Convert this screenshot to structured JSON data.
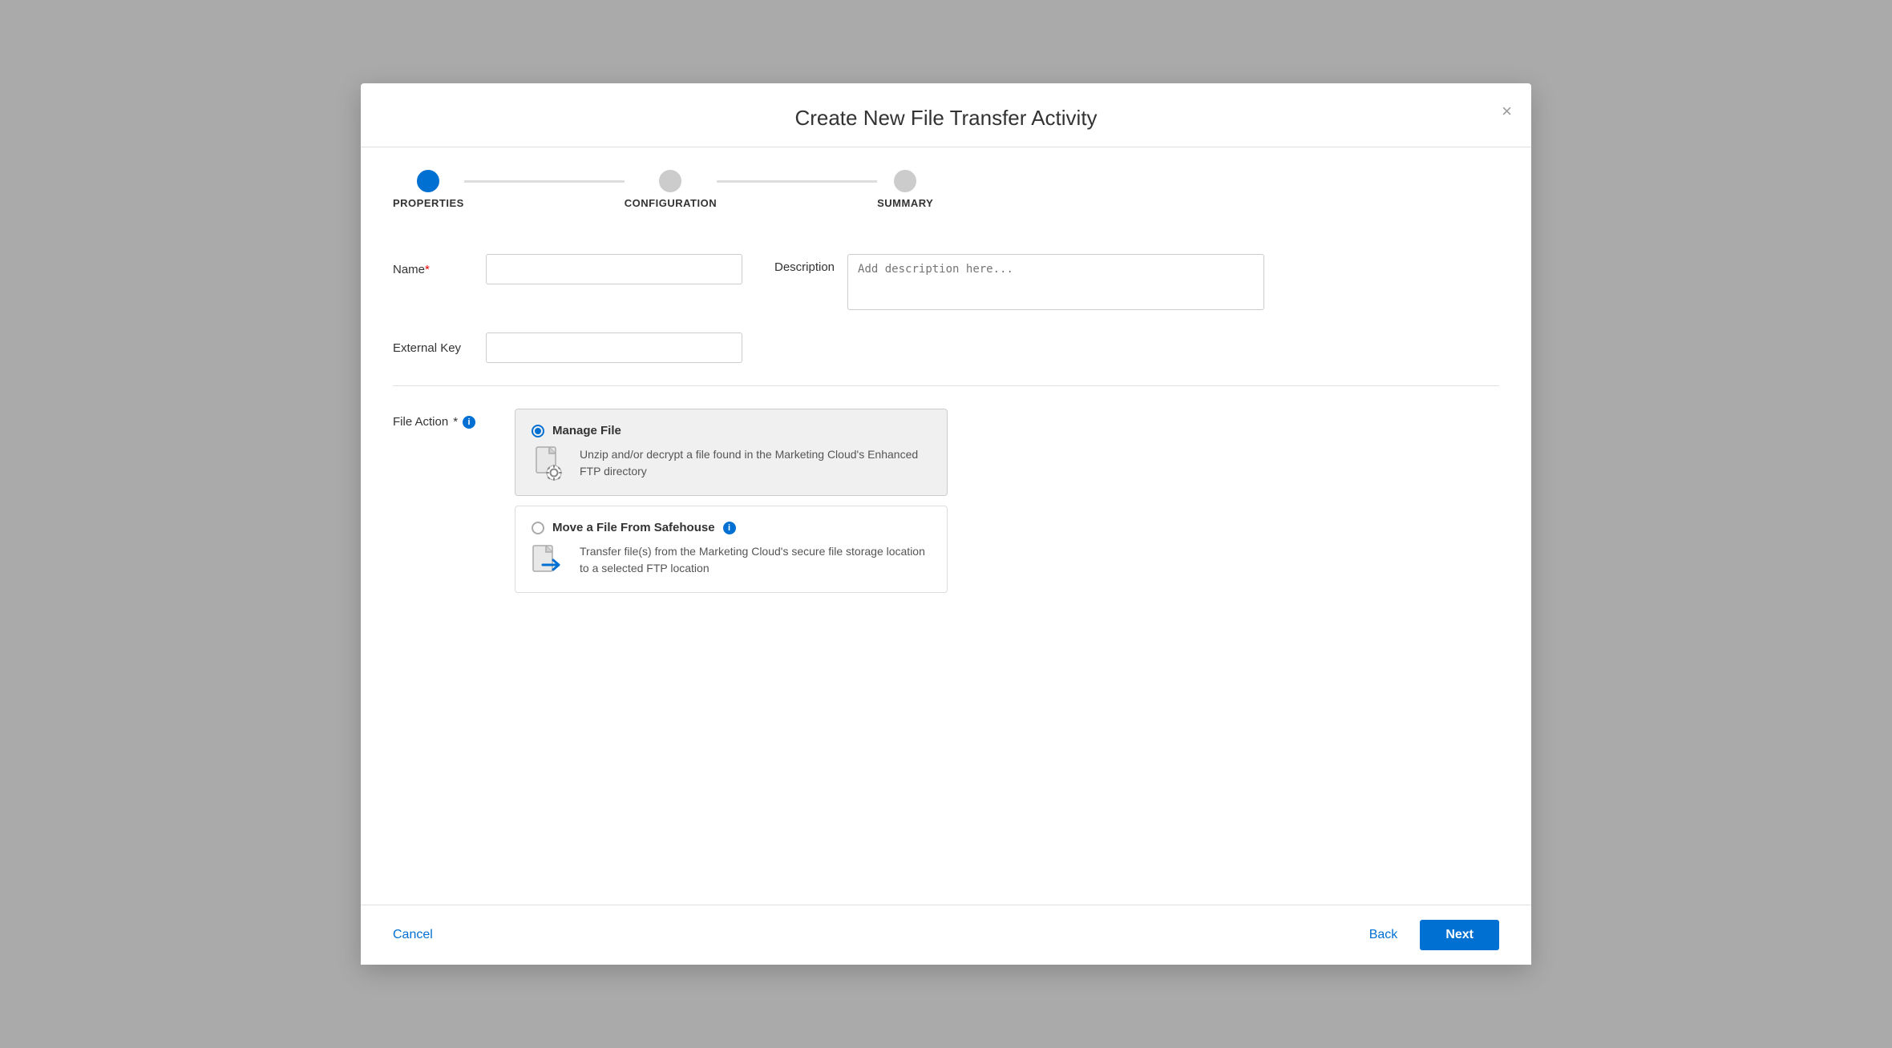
{
  "modal": {
    "title": "Create New File Transfer Activity",
    "close_label": "×"
  },
  "stepper": {
    "steps": [
      {
        "label": "PROPERTIES",
        "state": "active"
      },
      {
        "label": "CONFIGURATION",
        "state": "inactive"
      },
      {
        "label": "SUMMARY",
        "state": "inactive"
      }
    ]
  },
  "form": {
    "name_label": "Name",
    "name_required": "*",
    "name_placeholder": "",
    "external_key_label": "External Key",
    "external_key_placeholder": "",
    "description_label": "Description",
    "description_placeholder": "Add description here..."
  },
  "file_action": {
    "label": "File Action",
    "required": "*",
    "options": [
      {
        "id": "manage-file",
        "title": "Manage File",
        "description": "Unzip and/or decrypt a file found in the Marketing Cloud's Enhanced FTP directory",
        "selected": true
      },
      {
        "id": "move-file",
        "title": "Move a File From Safehouse",
        "description": "Transfer file(s) from the Marketing Cloud's secure file storage location to a selected FTP location",
        "selected": false,
        "has_info": true
      }
    ]
  },
  "footer": {
    "cancel_label": "Cancel",
    "back_label": "Back",
    "next_label": "Next"
  }
}
